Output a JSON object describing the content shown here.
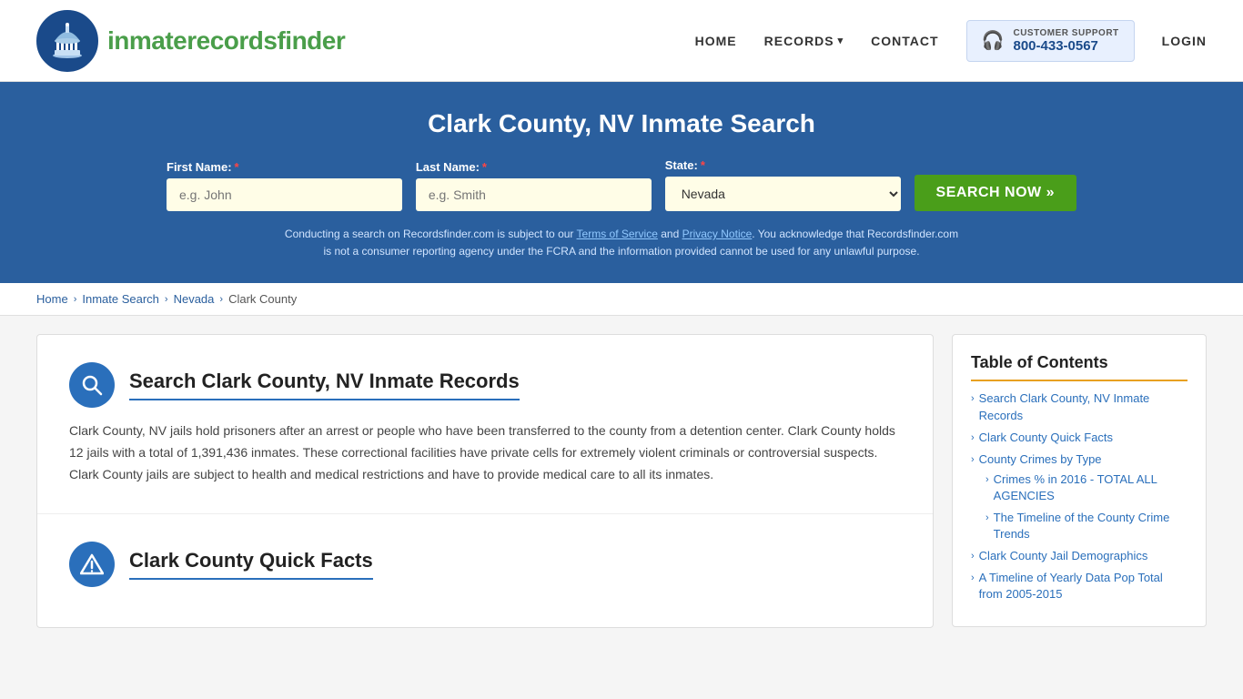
{
  "header": {
    "logo_text_part1": "inmaterecords",
    "logo_text_part2": "finder",
    "nav_home": "HOME",
    "nav_records": "RECORDS",
    "nav_contact": "CONTACT",
    "support_label": "CUSTOMER SUPPORT",
    "support_number": "800-433-0567",
    "nav_login": "LOGIN"
  },
  "hero": {
    "title": "Clark County, NV Inmate Search",
    "first_name_label": "First Name:",
    "first_name_placeholder": "e.g. John",
    "last_name_label": "Last Name:",
    "last_name_placeholder": "e.g. Smith",
    "state_label": "State:",
    "state_value": "Nevada",
    "search_button": "SEARCH NOW »",
    "disclaimer": "Conducting a search on Recordsfinder.com is subject to our Terms of Service and Privacy Notice. You acknowledge that Recordsfinder.com is not a consumer reporting agency under the FCRA and the information provided cannot be used for any unlawful purpose.",
    "disclaimer_link1": "Terms of Service",
    "disclaimer_link2": "Privacy Notice"
  },
  "breadcrumb": {
    "home": "Home",
    "inmate_search": "Inmate Search",
    "nevada": "Nevada",
    "clark_county": "Clark County"
  },
  "content": {
    "section1": {
      "title": "Search Clark County, NV Inmate Records",
      "body": "Clark County, NV jails hold prisoners after an arrest or people who have been transferred to the county from a detention center. Clark County holds 12 jails with a total of 1,391,436 inmates. These correctional facilities have private cells for extremely violent criminals or controversial suspects. Clark County jails are subject to health and medical restrictions and have to provide medical care to all its inmates."
    },
    "section2": {
      "title": "Clark County Quick Facts"
    }
  },
  "toc": {
    "title": "Table of Contents",
    "items": [
      {
        "label": "Search Clark County, NV Inmate Records",
        "sub": []
      },
      {
        "label": "Clark County Quick Facts",
        "sub": []
      },
      {
        "label": "County Crimes by Type",
        "sub": []
      },
      {
        "label": "Crimes % in 2016 - TOTAL ALL AGENCIES",
        "sub": []
      },
      {
        "label": "The Timeline of the County Crime Trends",
        "sub": []
      },
      {
        "label": "Clark County Jail Demographics",
        "sub": []
      },
      {
        "label": "A Timeline of Yearly Data Pop Total from 2005-2015",
        "sub": []
      }
    ]
  }
}
